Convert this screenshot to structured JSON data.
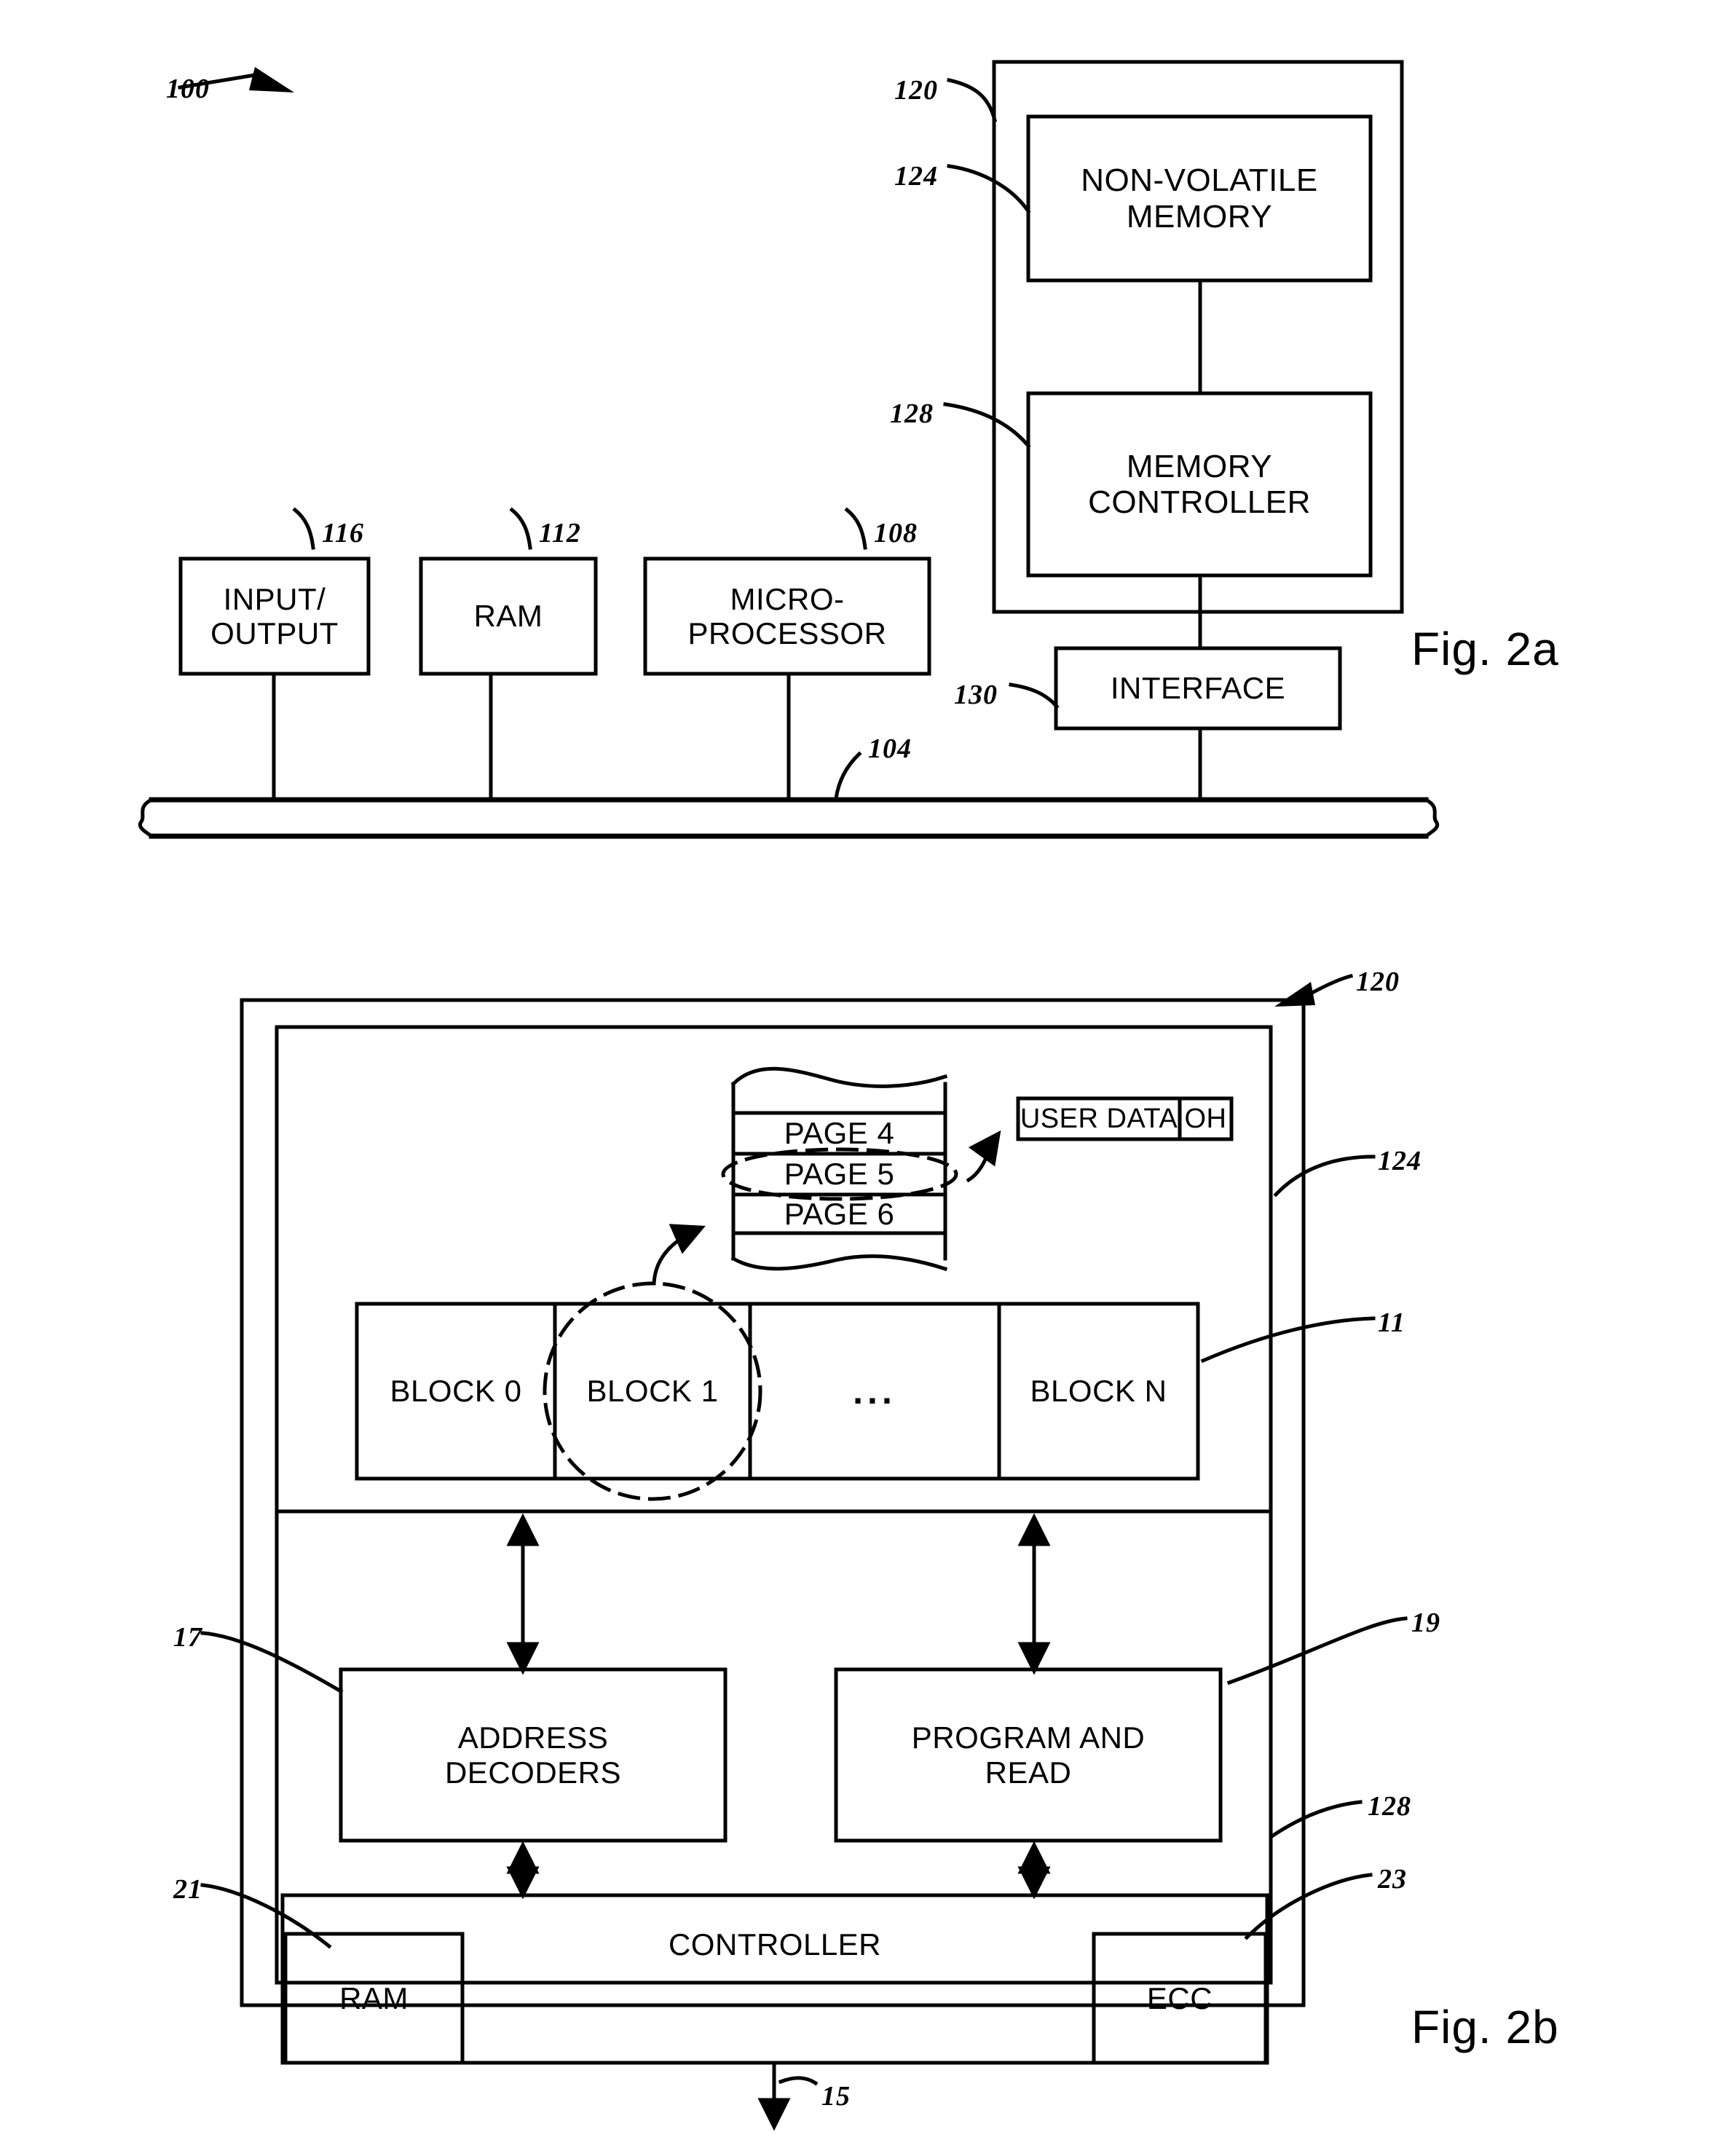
{
  "figures": {
    "fig2a": {
      "caption": "Fig. 2a",
      "system_ref": "100",
      "bus_ref": "104",
      "boxes": {
        "nonvolatile_memory": {
          "label": "NON-VOLATILE\nMEMORY",
          "ref": "124"
        },
        "memory_controller": {
          "label": "MEMORY\nCONTROLLER",
          "ref": "128"
        },
        "memory_system": {
          "ref": "120"
        },
        "interface": {
          "label": "INTERFACE",
          "ref": "130"
        },
        "input_output": {
          "label": "INPUT/\nOUTPUT",
          "ref": "116"
        },
        "ram": {
          "label": "RAM",
          "ref": "112"
        },
        "microprocessor": {
          "label": "MICRO-\nPROCESSOR",
          "ref": "108"
        }
      }
    },
    "fig2b": {
      "caption": "Fig. 2b",
      "device_ref": "120",
      "memory_array_ref": "124",
      "blocks_ref": "11",
      "address_decoders_ref": "17",
      "program_read_ref": "19",
      "controller_ref": "128",
      "controller_ram_ref": "21",
      "ecc_ref": "23",
      "host_bus_ref": "15",
      "pages": [
        {
          "label": "PAGE 4"
        },
        {
          "label": "PAGE 5"
        },
        {
          "label": "PAGE 6"
        }
      ],
      "page_fields": [
        {
          "label": "USER  DATA"
        },
        {
          "label": "OH"
        }
      ],
      "blocks": [
        {
          "label": "BLOCK 0"
        },
        {
          "label": "BLOCK 1"
        },
        {
          "label": "..."
        },
        {
          "label": "BLOCK N"
        }
      ],
      "boxes": {
        "address_decoders": {
          "label": "ADDRESS\nDECODERS"
        },
        "program_and_read": {
          "label": "PROGRAM AND\nREAD"
        },
        "controller": {
          "label": "CONTROLLER"
        },
        "controller_ram": {
          "label": "RAM"
        },
        "ecc": {
          "label": "ECC"
        }
      }
    }
  },
  "colors": {
    "ink": "#000000",
    "paper": "#ffffff"
  }
}
